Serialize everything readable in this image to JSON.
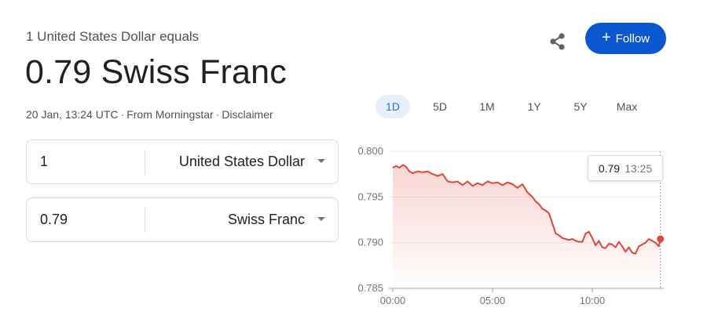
{
  "header": {
    "subtitle": "1 United States Dollar equals",
    "value": "0.79 Swiss Franc",
    "timestamp": "20 Jan, 13:24 UTC",
    "source": "From Morningstar",
    "disclaimer": "Disclaimer",
    "separator": "·"
  },
  "actions": {
    "share_icon": "share-icon",
    "follow_label": "Follow",
    "follow_icon": "+",
    "accent_color": "#0b57d0"
  },
  "range_tabs": [
    {
      "label": "1D",
      "active": true
    },
    {
      "label": "5D",
      "active": false
    },
    {
      "label": "1M",
      "active": false
    },
    {
      "label": "1Y",
      "active": false
    },
    {
      "label": "5Y",
      "active": false
    },
    {
      "label": "Max",
      "active": false
    }
  ],
  "converter": {
    "from": {
      "amount": "1",
      "currency": "United States Dollar"
    },
    "to": {
      "amount": "0.79",
      "currency": "Swiss Franc"
    }
  },
  "tooltip": {
    "value": "0.79",
    "time": "13:25"
  },
  "chart_data": {
    "type": "area",
    "line_color": "#e0453a",
    "ylim": [
      0.785,
      0.8
    ],
    "yticks": [
      "0.800",
      "0.795",
      "0.790",
      "0.785"
    ],
    "xticks": [
      "00:00",
      "05:00",
      "10:00"
    ],
    "grid": true,
    "series": [
      {
        "x": [
          "00:00",
          "00:10",
          "00:20",
          "00:30",
          "00:40",
          "00:50",
          "01:00",
          "01:15",
          "01:30",
          "01:45",
          "02:00",
          "02:15",
          "02:30",
          "02:45",
          "03:00",
          "03:15",
          "03:30",
          "03:45",
          "04:00",
          "04:15",
          "04:30",
          "04:45",
          "05:00",
          "05:15",
          "05:30",
          "05:45",
          "06:00",
          "06:15",
          "06:30",
          "06:45",
          "07:00",
          "07:10",
          "07:20",
          "07:30",
          "07:40",
          "07:50",
          "08:00",
          "08:10",
          "08:20",
          "08:30",
          "08:40",
          "08:50",
          "09:00",
          "09:10",
          "09:20",
          "09:30",
          "09:40",
          "09:50",
          "10:00",
          "10:10",
          "10:20",
          "10:30",
          "10:40",
          "10:50",
          "11:00",
          "11:10",
          "11:20",
          "11:30",
          "11:40",
          "11:50",
          "12:00",
          "12:10",
          "12:20",
          "12:30",
          "12:40",
          "12:50",
          "13:00",
          "13:10",
          "13:20",
          "13:25"
        ],
        "values": [
          0.7982,
          0.7984,
          0.7982,
          0.7985,
          0.7983,
          0.7978,
          0.7976,
          0.7978,
          0.7977,
          0.7978,
          0.7975,
          0.7973,
          0.7975,
          0.7967,
          0.7966,
          0.7967,
          0.7963,
          0.7967,
          0.7962,
          0.7965,
          0.7963,
          0.7967,
          0.7965,
          0.7966,
          0.7963,
          0.7966,
          0.7964,
          0.796,
          0.7964,
          0.7955,
          0.795,
          0.7945,
          0.7942,
          0.7937,
          0.7935,
          0.7932,
          0.7921,
          0.791,
          0.7908,
          0.7905,
          0.7904,
          0.7903,
          0.7904,
          0.7902,
          0.7901,
          0.7901,
          0.791,
          0.7912,
          0.7905,
          0.7897,
          0.7902,
          0.7895,
          0.7894,
          0.7899,
          0.7898,
          0.7895,
          0.7901,
          0.7896,
          0.789,
          0.7895,
          0.7889,
          0.7888,
          0.7896,
          0.7898,
          0.79,
          0.7904,
          0.7902,
          0.79,
          0.7896,
          0.7904
        ]
      }
    ]
  }
}
